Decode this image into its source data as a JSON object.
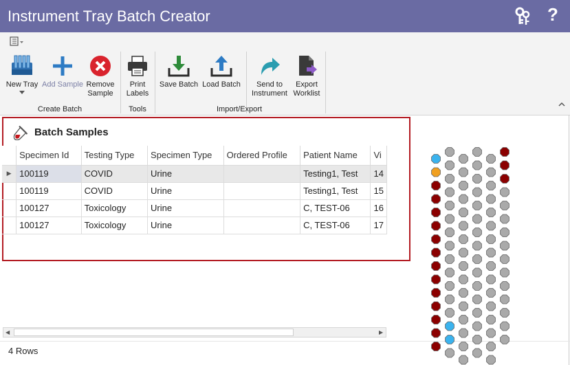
{
  "window": {
    "title": "Instrument Tray Batch Creator"
  },
  "titlebar": {
    "help_label": "?"
  },
  "ribbon": {
    "groups": [
      {
        "label": "Create Batch"
      },
      {
        "label": "Tools"
      },
      {
        "label": "Import/Export"
      }
    ],
    "buttons": {
      "new_tray": "New Tray",
      "add_sample": "Add Sample",
      "remove_sample_1": "Remove",
      "remove_sample_2": "Sample",
      "print_labels_1": "Print",
      "print_labels_2": "Labels",
      "save_batch": "Save Batch",
      "load_batch": "Load Batch",
      "send_instrument_1": "Send to",
      "send_instrument_2": "Instrument",
      "export_worklist_1": "Export",
      "export_worklist_2": "Worklist"
    }
  },
  "panel": {
    "title": "Batch Samples"
  },
  "grid": {
    "columns": [
      "Specimen Id",
      "Testing Type",
      "Specimen Type",
      "Ordered Profile",
      "Patient Name",
      "Vi"
    ],
    "rows": [
      [
        "100119",
        "COVID",
        "Urine",
        "",
        "Testing1, Test",
        "14"
      ],
      [
        "100119",
        "COVID",
        "Urine",
        "",
        "Testing1, Test",
        "15"
      ],
      [
        "100127",
        "Toxicology",
        "Urine",
        "",
        "C, TEST-06",
        "16"
      ],
      [
        "100127",
        "Toxicology",
        "Urine",
        "",
        "C, TEST-06",
        "17"
      ]
    ],
    "selected_row": 0,
    "row_count_label": "4 Rows"
  },
  "tray": {
    "colors": {
      "empty": "#aaaaaa",
      "dark_red": "#8b0000",
      "blue": "#3bb3ee",
      "orange": "#f0a020"
    },
    "columns": [
      {
        "slots": [
          "blue",
          "orange",
          "dark_red",
          "dark_red",
          "dark_red",
          "dark_red",
          "dark_red",
          "dark_red",
          "dark_red",
          "dark_red",
          "dark_red",
          "dark_red",
          "dark_red",
          "dark_red",
          "dark_red"
        ]
      },
      {
        "slots": [
          "empty",
          "empty",
          "empty",
          "empty",
          "empty",
          "empty",
          "empty",
          "empty",
          "empty",
          "empty",
          "empty",
          "empty",
          "empty",
          "blue",
          "blue",
          "empty"
        ]
      },
      {
        "slots": [
          "empty",
          "empty",
          "empty",
          "empty",
          "empty",
          "empty",
          "empty",
          "empty",
          "empty",
          "empty",
          "empty",
          "empty",
          "empty",
          "empty",
          "empty",
          "empty"
        ]
      },
      {
        "slots": [
          "empty",
          "empty",
          "empty",
          "empty",
          "empty",
          "empty",
          "empty",
          "empty",
          "empty",
          "empty",
          "empty",
          "empty",
          "empty",
          "empty",
          "empty",
          "empty"
        ]
      },
      {
        "slots": [
          "empty",
          "empty",
          "empty",
          "empty",
          "empty",
          "empty",
          "empty",
          "empty",
          "empty",
          "empty",
          "empty",
          "empty",
          "empty",
          "empty",
          "empty",
          "empty"
        ]
      },
      {
        "slots": [
          "dark_red",
          "dark_red",
          "dark_red",
          "empty",
          "empty",
          "empty",
          "empty",
          "empty",
          "empty",
          "empty",
          "empty",
          "empty",
          "empty",
          "empty",
          "empty"
        ]
      }
    ]
  }
}
